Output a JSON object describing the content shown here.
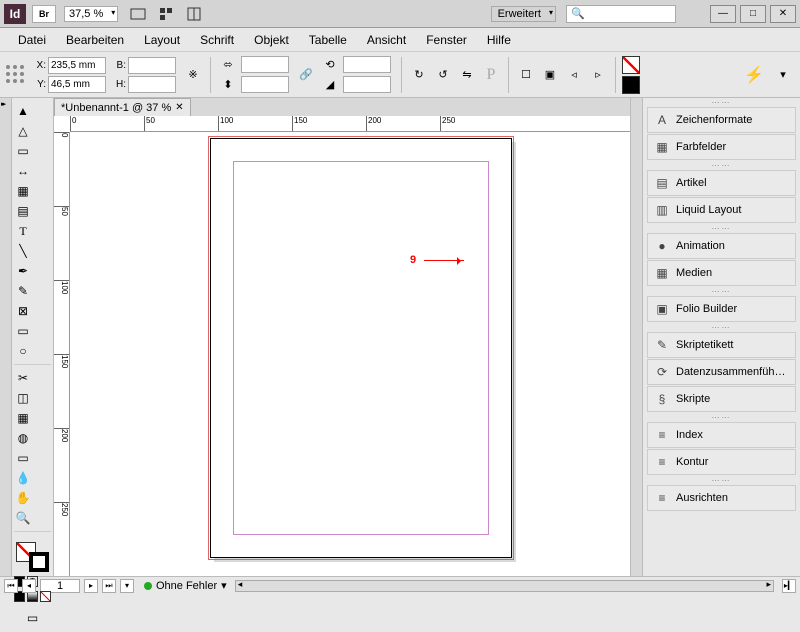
{
  "app": {
    "logo": "Id",
    "bridge": "Br",
    "zoom": "37,5 %",
    "workspace": "Erweitert"
  },
  "win": {
    "min": "—",
    "max": "□",
    "close": "✕"
  },
  "menu": [
    "Datei",
    "Bearbeiten",
    "Layout",
    "Schrift",
    "Objekt",
    "Tabelle",
    "Ansicht",
    "Fenster",
    "Hilfe"
  ],
  "ctrl": {
    "x_label": "X:",
    "x": "235,5 mm",
    "y_label": "Y:",
    "y": "46,5 mm",
    "w_label": "B:",
    "w": "",
    "h_label": "H:",
    "h": ""
  },
  "doc": {
    "tab_title": "*Unbenannt-1 @ 37 %"
  },
  "ruler_h": [
    0,
    50,
    100,
    150,
    200,
    250
  ],
  "ruler_v": [
    0,
    50,
    100,
    150,
    200,
    250
  ],
  "annotation": "9",
  "panels": [
    [
      "Zeichenformate",
      "A"
    ],
    [
      "Farbfelder",
      "▦"
    ],
    [
      "Artikel",
      "▤"
    ],
    [
      "Liquid Layout",
      "▥"
    ],
    [
      "Animation",
      "●"
    ],
    [
      "Medien",
      "▦"
    ],
    [
      "Folio Builder",
      "▣"
    ],
    [
      "Skriptetikett",
      "✎"
    ],
    [
      "Datenzusammenfüh…",
      "⟳"
    ],
    [
      "Skripte",
      "§"
    ],
    [
      "Index",
      "≡"
    ],
    [
      "Kontur",
      "≡"
    ],
    [
      "Ausrichten",
      "≡"
    ]
  ],
  "status": {
    "page": "1",
    "preflight": "Ohne Fehler"
  }
}
